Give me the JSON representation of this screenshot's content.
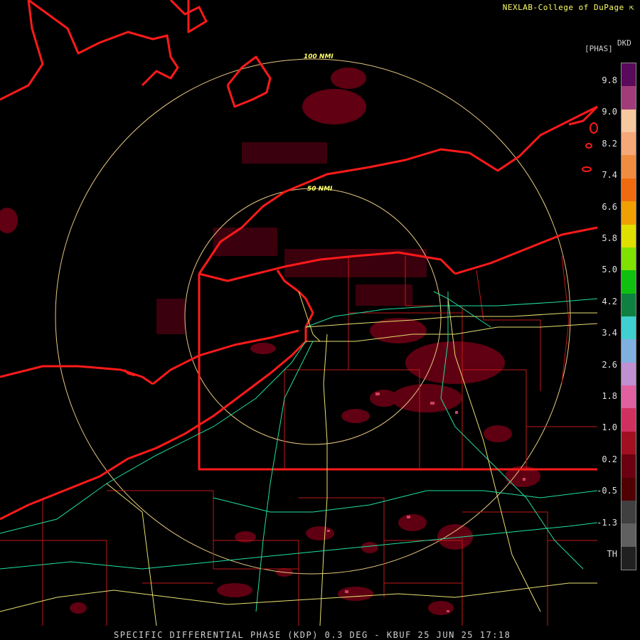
{
  "credit": "NEXLAB-College of DuPage",
  "credit_icon": "cursor-arrow-icon",
  "legend": {
    "unit": "[PHAS]",
    "product_code": "DKD",
    "labels": [
      "9.8",
      "9.0",
      "8.2",
      "7.4",
      "6.6",
      "5.8",
      "5.0",
      "4.2",
      "3.4",
      "2.6",
      "1.8",
      "1.0",
      "0.2",
      "-0.5",
      "-1.3",
      "TH"
    ],
    "colors": [
      "#5a0a5a",
      "#a03c7a",
      "#f5c8a0",
      "#f5a878",
      "#f08c40",
      "#f06a10",
      "#f0a000",
      "#e0e000",
      "#80e000",
      "#10c010",
      "#108040",
      "#40d0d0",
      "#80b0e0",
      "#c090d0",
      "#e060a0",
      "#d03060",
      "#a01020",
      "#6a0010",
      "#500000",
      "#404040",
      "#606060",
      "#202020"
    ]
  },
  "range_rings": [
    {
      "label": "100 NMI"
    },
    {
      "label": "50 NMI"
    }
  ],
  "footer": "SPECIFIC DIFFERENTIAL PHASE (KDP) 0.3 DEG - KBUF 25 JUN 25 17:18"
}
